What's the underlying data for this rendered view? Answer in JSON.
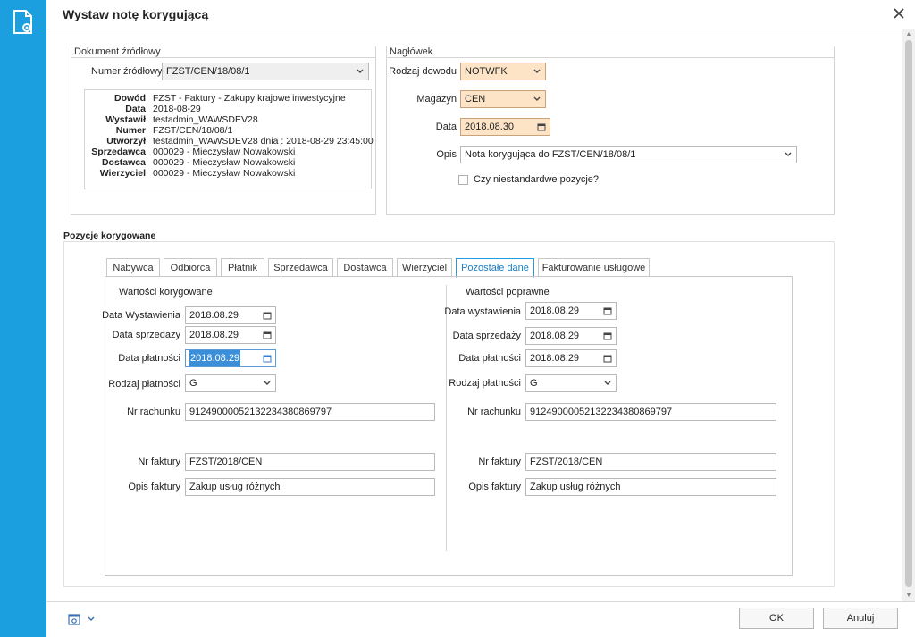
{
  "window": {
    "title": "Wystaw notę korygującą"
  },
  "source_doc": {
    "group_title": "Dokument źródłowy",
    "number_label": "Numer źródłowy",
    "number_value": "FZST/CEN/18/08/1",
    "info": [
      {
        "key": "Dowód",
        "value": "FZST - Faktury - Zakupy krajowe inwestycyjne"
      },
      {
        "key": "Data",
        "value": "2018-08-29"
      },
      {
        "key": "Wystawił",
        "value": "testadmin_WAWSDEV28"
      },
      {
        "key": "Numer",
        "value": "FZST/CEN/18/08/1"
      },
      {
        "key": "Utworzył",
        "value": "testadmin_WAWSDEV28 dnia : 2018-08-29 23:45:00"
      },
      {
        "key": "Sprzedawca",
        "value": "000029 - Mieczysław Nowakowski"
      },
      {
        "key": "Dostawca",
        "value": "000029 - Mieczysław Nowakowski"
      },
      {
        "key": "Wierzyciel",
        "value": "000029 - Mieczysław Nowakowski"
      }
    ]
  },
  "header": {
    "group_title": "Nagłówek",
    "doc_type_label": "Rodzaj dowodu",
    "doc_type_value": "NOTWFK",
    "warehouse_label": "Magazyn",
    "warehouse_value": "CEN",
    "date_label": "Data",
    "date_value": "2018.08.30",
    "desc_label": "Opis",
    "desc_value": "Nota korygująca do FZST/CEN/18/08/1",
    "nonstandard_label": "Czy niestandardwe pozycje?",
    "nonstandard_checked": false
  },
  "positions": {
    "heading": "Pozycje korygowane",
    "tabs": [
      "Nabywca",
      "Odbiorca",
      "Płatnik",
      "Sprzedawca",
      "Dostawca",
      "Wierzyciel",
      "Pozostałe dane",
      "Fakturowanie usługowe"
    ],
    "active_tab": "Pozostałe dane",
    "corrected": {
      "title": "Wartości korygowane",
      "issue_date_label": "Data Wystawienia",
      "issue_date": "2018.08.29",
      "sale_date_label": "Data sprzedaży",
      "sale_date": "2018.08.29",
      "payment_date_label": "Data płatności",
      "payment_date": "2018.08.29",
      "payment_type_label": "Rodzaj płatności",
      "payment_type": "G",
      "account_label": "Nr rachunku",
      "account": "91249000052132234380869797",
      "invoice_no_label": "Nr faktury",
      "invoice_no": "FZST/2018/CEN",
      "invoice_desc_label": "Opis faktury",
      "invoice_desc": "Zakup usług różnych"
    },
    "correct": {
      "title": "Wartości poprawne",
      "issue_date_label": "Data wystawienia",
      "issue_date": "2018.08.29",
      "sale_date_label": "Data sprzedaży",
      "sale_date": "2018.08.29",
      "payment_date_label": "Data płatności",
      "payment_date": "2018.08.29",
      "payment_type_label": "Rodzaj płatności",
      "payment_type": "G",
      "account_label": "Nr rachunku",
      "account": "91249000052132234380869797",
      "invoice_no_label": "Nr faktury",
      "invoice_no": "FZST/2018/CEN",
      "invoice_desc_label": "Opis faktury",
      "invoice_desc": "Zakup usług różnych"
    }
  },
  "footer": {
    "ok_label": "OK",
    "cancel_label": "Anuluj"
  },
  "icons": {
    "app": "document-gear-icon",
    "close": "close-icon",
    "settings": "settings-icon",
    "dropdown": "chevron-down-icon",
    "calendar": "calendar-icon"
  },
  "colors": {
    "sidebar": "#1b9fde",
    "highlight_field": "#fde4c7",
    "active_tab": "#1b7fc4"
  }
}
